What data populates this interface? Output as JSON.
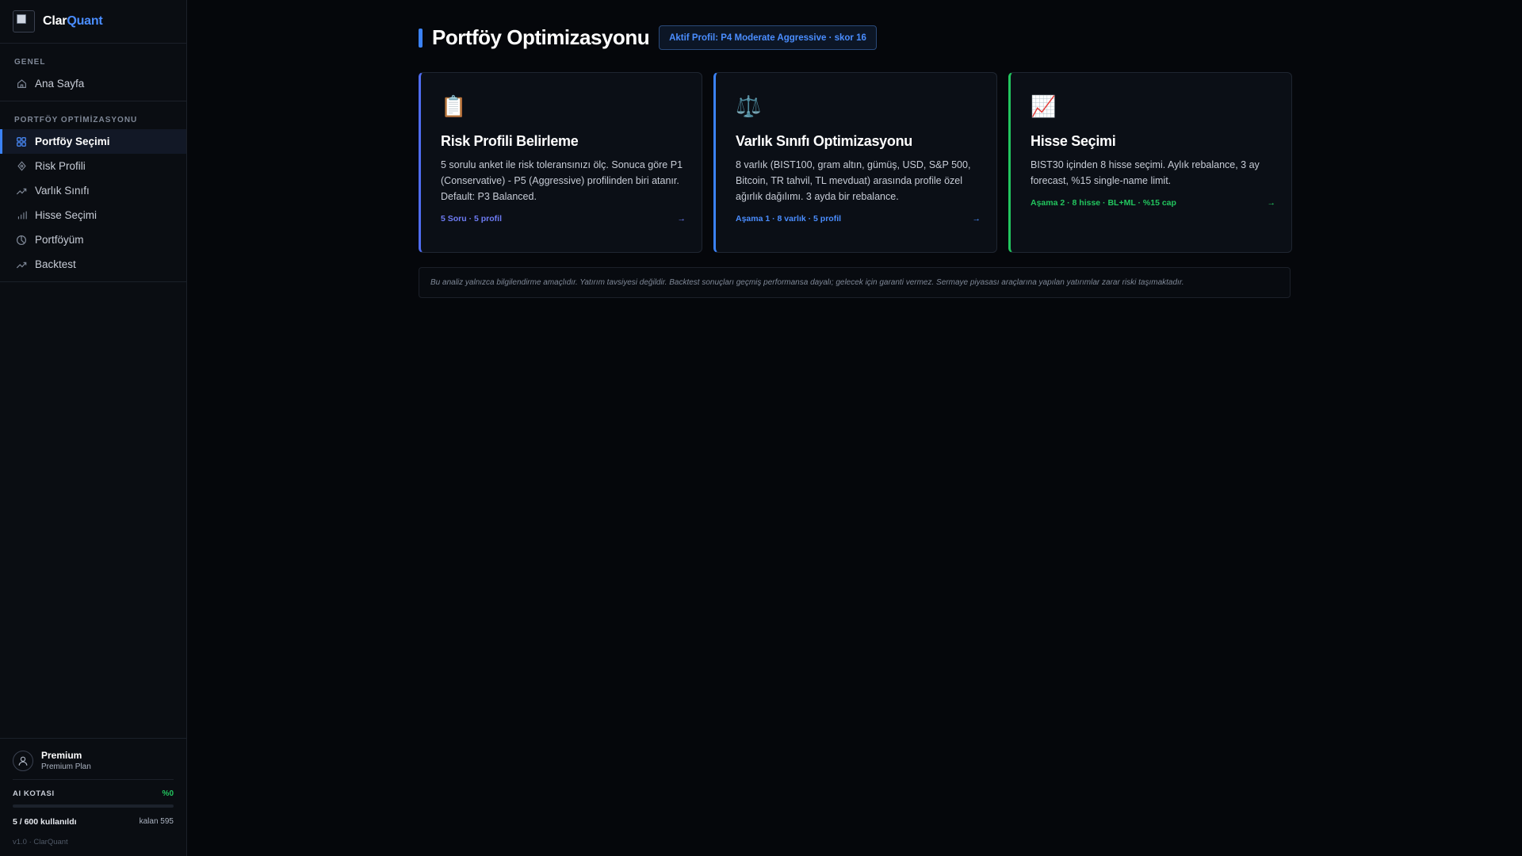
{
  "brand": {
    "name_part1": "Clar",
    "name_part2": "Quant"
  },
  "sidebar": {
    "groups": [
      {
        "title": "GENEL",
        "items": [
          {
            "label": "Ana Sayfa",
            "icon": "home-icon"
          }
        ]
      },
      {
        "title": "PORTFÖY OPTİMİZASYONU",
        "items": [
          {
            "label": "Portföy Seçimi",
            "icon": "grid-icon",
            "active": true
          },
          {
            "label": "Risk Profili",
            "icon": "crosshair-icon"
          },
          {
            "label": "Varlık Sınıfı",
            "icon": "trend-icon"
          },
          {
            "label": "Hisse Seçimi",
            "icon": "bar-chart-icon"
          },
          {
            "label": "Portföyüm",
            "icon": "pie-icon"
          },
          {
            "label": "Backtest",
            "icon": "trend-icon"
          }
        ]
      }
    ],
    "user": {
      "name": "Premium",
      "plan": "Premium Plan"
    },
    "quota": {
      "label": "AI KOTASI",
      "percent_text": "%0",
      "percent": 0,
      "used": "5 / 600 kullanıldı",
      "left": "kalan 595"
    },
    "version": "v1.0 · ClarQuant"
  },
  "header": {
    "title": "Portföy Optimizasyonu",
    "badge": "Aktif Profil: P4 Moderate Aggressive · skor 16"
  },
  "cards": [
    {
      "icon": "clipboard-icon",
      "title": "Risk Profili Belirleme",
      "desc": "5 sorulu anket ile risk toleransınızı ölç. Sonuca göre P1 (Conservative) - P5 (Aggressive) profilinden biri atanır. Default: P3 Balanced.",
      "meta": "5 Soru · 5 profil",
      "arrow": "→"
    },
    {
      "icon": "scales-icon",
      "title": "Varlık Sınıfı Optimizasyonu",
      "desc": "8 varlık (BIST100, gram altın, gümüş, USD, S&P 500, Bitcoin, TR tahvil, TL mevduat) arasında profile özel ağırlık dağılımı. 3 ayda bir rebalance.",
      "meta": "Aşama 1 · 8 varlık · 5 profil",
      "arrow": "→"
    },
    {
      "icon": "chart-up-icon",
      "title": "Hisse Seçimi",
      "desc": "BIST30 içinden 8 hisse seçimi. Aylık rebalance, 3 ay forecast, %15 single-name limit.",
      "meta": "Aşama 2 · 8 hisse · BL+ML · %15 cap",
      "arrow": "→"
    }
  ],
  "disclaimer": "Bu analiz yalnızca bilgilendirme amaçlıdır. Yatırım tavsiyesi değildir. Backtest sonuçları geçmiş performansa dayalı; gelecek için garanti vermez. Sermaye piyasası araçlarına yapılan yatırımlar zarar riski taşımaktadır."
}
